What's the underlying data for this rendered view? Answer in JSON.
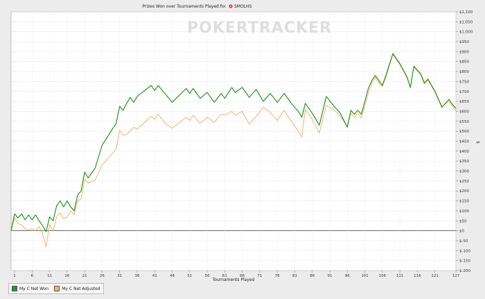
{
  "chart_data": {
    "type": "line",
    "title": "Prizes Won over Tournaments Played for",
    "player": "SMOLHS",
    "watermark": "POKERTRACKER",
    "xlabel": "Tournaments Played",
    "ylabel": "$",
    "xlim": [
      0,
      127
    ],
    "ylim": [
      -200,
      1100
    ],
    "x_ticks": [
      1,
      6,
      11,
      16,
      21,
      26,
      31,
      36,
      41,
      46,
      51,
      56,
      61,
      66,
      71,
      76,
      81,
      86,
      91,
      96,
      101,
      106,
      111,
      116,
      121,
      127
    ],
    "y_ticks": [
      {
        "v": 1100,
        "label": "$1,100"
      },
      {
        "v": 1050,
        "label": "$1,050"
      },
      {
        "v": 1000,
        "label": "$1,000"
      },
      {
        "v": 950,
        "label": "$950"
      },
      {
        "v": 900,
        "label": "$900"
      },
      {
        "v": 850,
        "label": "$850"
      },
      {
        "v": 800,
        "label": "$800"
      },
      {
        "v": 750,
        "label": "$750"
      },
      {
        "v": 700,
        "label": "$700"
      },
      {
        "v": 650,
        "label": "$650"
      },
      {
        "v": 600,
        "label": "$600"
      },
      {
        "v": 550,
        "label": "$550"
      },
      {
        "v": 500,
        "label": "$500"
      },
      {
        "v": 450,
        "label": "$450"
      },
      {
        "v": 400,
        "label": "$400"
      },
      {
        "v": 350,
        "label": "$350"
      },
      {
        "v": 300,
        "label": "$300"
      },
      {
        "v": 250,
        "label": "$250"
      },
      {
        "v": 200,
        "label": "$200"
      },
      {
        "v": 150,
        "label": "$150"
      },
      {
        "v": 100,
        "label": "$100"
      },
      {
        "v": 50,
        "label": "$50"
      },
      {
        "v": 0,
        "label": "$0"
      },
      {
        "v": -50,
        "label": "$-50"
      },
      {
        "v": -100,
        "label": "$-100"
      },
      {
        "v": -150,
        "label": "$-150"
      },
      {
        "v": -200,
        "label": "$-200"
      }
    ],
    "grid": true,
    "legend_position": "bottom-left",
    "series": [
      {
        "name": "My C Net Won",
        "color": "#1f9a1f",
        "points": [
          [
            0,
            0
          ],
          [
            1,
            85
          ],
          [
            2,
            65
          ],
          [
            3,
            85
          ],
          [
            4,
            55
          ],
          [
            5,
            80
          ],
          [
            6,
            55
          ],
          [
            7,
            80
          ],
          [
            8,
            50
          ],
          [
            9,
            25
          ],
          [
            10,
            -5
          ],
          [
            11,
            70
          ],
          [
            12,
            50
          ],
          [
            13,
            125
          ],
          [
            14,
            150
          ],
          [
            15,
            120
          ],
          [
            16,
            150
          ],
          [
            17,
            120
          ],
          [
            18,
            100
          ],
          [
            19,
            180
          ],
          [
            20,
            200
          ],
          [
            21,
            295
          ],
          [
            22,
            265
          ],
          [
            24,
            315
          ],
          [
            26,
            430
          ],
          [
            30,
            540
          ],
          [
            31,
            625
          ],
          [
            32,
            605
          ],
          [
            33,
            640
          ],
          [
            34,
            670
          ],
          [
            35,
            645
          ],
          [
            36,
            675
          ],
          [
            40,
            730
          ],
          [
            41,
            705
          ],
          [
            42,
            730
          ],
          [
            46,
            645
          ],
          [
            50,
            715
          ],
          [
            51,
            690
          ],
          [
            52,
            715
          ],
          [
            54,
            665
          ],
          [
            56,
            695
          ],
          [
            58,
            645
          ],
          [
            60,
            690
          ],
          [
            61,
            665
          ],
          [
            63,
            720
          ],
          [
            64,
            695
          ],
          [
            66,
            720
          ],
          [
            68,
            670
          ],
          [
            70,
            710
          ],
          [
            72,
            650
          ],
          [
            74,
            690
          ],
          [
            76,
            645
          ],
          [
            78,
            690
          ],
          [
            80,
            640
          ],
          [
            82,
            600
          ],
          [
            83,
            570
          ],
          [
            84,
            640
          ],
          [
            86,
            590
          ],
          [
            88,
            530
          ],
          [
            90,
            675
          ],
          [
            92,
            630
          ],
          [
            94,
            590
          ],
          [
            96,
            520
          ],
          [
            97,
            605
          ],
          [
            98,
            585
          ],
          [
            99,
            605
          ],
          [
            100,
            585
          ],
          [
            102,
            715
          ],
          [
            103,
            755
          ],
          [
            104,
            780
          ],
          [
            105,
            755
          ],
          [
            106,
            730
          ],
          [
            107,
            780
          ],
          [
            109,
            890
          ],
          [
            111,
            840
          ],
          [
            113,
            775
          ],
          [
            114,
            720
          ],
          [
            115,
            825
          ],
          [
            116,
            805
          ],
          [
            117,
            785
          ],
          [
            118,
            740
          ],
          [
            119,
            760
          ],
          [
            121,
            700
          ],
          [
            123,
            620
          ],
          [
            125,
            660
          ],
          [
            126,
            635
          ],
          [
            127,
            615
          ]
        ]
      },
      {
        "name": "My C Net Adjusted",
        "color": "#f5b26a",
        "points": [
          [
            0,
            0
          ],
          [
            1,
            65
          ],
          [
            2,
            35
          ],
          [
            3,
            30
          ],
          [
            4,
            10
          ],
          [
            5,
            5
          ],
          [
            6,
            10
          ],
          [
            7,
            0
          ],
          [
            8,
            20
          ],
          [
            9,
            -15
          ],
          [
            10,
            -80
          ],
          [
            11,
            30
          ],
          [
            12,
            0
          ],
          [
            13,
            70
          ],
          [
            14,
            90
          ],
          [
            15,
            60
          ],
          [
            16,
            70
          ],
          [
            17,
            100
          ],
          [
            18,
            80
          ],
          [
            19,
            150
          ],
          [
            20,
            160
          ],
          [
            21,
            260
          ],
          [
            22,
            240
          ],
          [
            24,
            255
          ],
          [
            26,
            330
          ],
          [
            30,
            410
          ],
          [
            31,
            505
          ],
          [
            32,
            480
          ],
          [
            33,
            485
          ],
          [
            34,
            500
          ],
          [
            35,
            520
          ],
          [
            36,
            510
          ],
          [
            40,
            575
          ],
          [
            41,
            560
          ],
          [
            42,
            585
          ],
          [
            44,
            540
          ],
          [
            46,
            515
          ],
          [
            50,
            570
          ],
          [
            51,
            555
          ],
          [
            52,
            580
          ],
          [
            54,
            540
          ],
          [
            56,
            570
          ],
          [
            58,
            545
          ],
          [
            60,
            585
          ],
          [
            61,
            580
          ],
          [
            63,
            600
          ],
          [
            64,
            580
          ],
          [
            66,
            600
          ],
          [
            68,
            535
          ],
          [
            70,
            575
          ],
          [
            72,
            620
          ],
          [
            74,
            595
          ],
          [
            76,
            555
          ],
          [
            78,
            605
          ],
          [
            80,
            550
          ],
          [
            82,
            500
          ],
          [
            83,
            470
          ],
          [
            84,
            610
          ],
          [
            86,
            560
          ],
          [
            88,
            490
          ],
          [
            90,
            630
          ],
          [
            92,
            610
          ],
          [
            94,
            575
          ],
          [
            96,
            525
          ],
          [
            97,
            590
          ],
          [
            98,
            570
          ],
          [
            99,
            590
          ],
          [
            100,
            565
          ],
          [
            102,
            690
          ],
          [
            103,
            740
          ],
          [
            104,
            770
          ],
          [
            105,
            745
          ],
          [
            106,
            725
          ],
          [
            107,
            770
          ],
          [
            109,
            885
          ],
          [
            111,
            835
          ],
          [
            113,
            770
          ],
          [
            114,
            720
          ],
          [
            115,
            830
          ],
          [
            116,
            810
          ],
          [
            117,
            790
          ],
          [
            118,
            745
          ],
          [
            119,
            765
          ],
          [
            121,
            705
          ],
          [
            123,
            625
          ],
          [
            125,
            650
          ],
          [
            126,
            625
          ],
          [
            127,
            605
          ]
        ]
      }
    ]
  }
}
